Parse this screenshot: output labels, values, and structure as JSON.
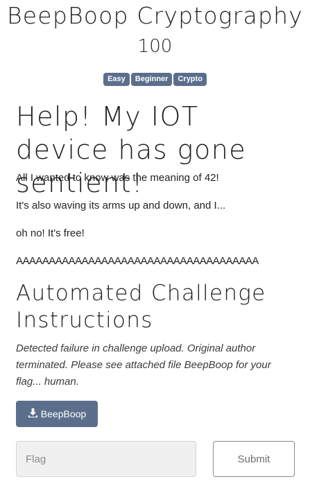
{
  "challenge": {
    "title": "BeepBoop Cryptography",
    "points": "100",
    "tags": [
      "Easy",
      "Beginner",
      "Crypto"
    ]
  },
  "description": {
    "heading": "Help! My IOT device has gone sentient!",
    "paragraphs": [
      "All I wanted to know was the meaning of 42!",
      "It's also waving its arms up and down, and I...",
      "oh no! It's free!",
      "AAAAAAAAAAAAAAAAAAAAAAAAAAAAAAAAAAAAA"
    ]
  },
  "instructions": {
    "heading": "Automated Challenge Instructions",
    "text": "Detected failure in challenge upload. Original author terminated. Please see attached file BeepBoop for your flag... human."
  },
  "file": {
    "label": "BeepBoop",
    "icon": "download-icon"
  },
  "form": {
    "flag_placeholder": "Flag",
    "flag_value": "",
    "submit_label": "Submit"
  },
  "colors": {
    "tag_bg": "#5b6f8c",
    "button_bg": "#5b6f8c"
  }
}
